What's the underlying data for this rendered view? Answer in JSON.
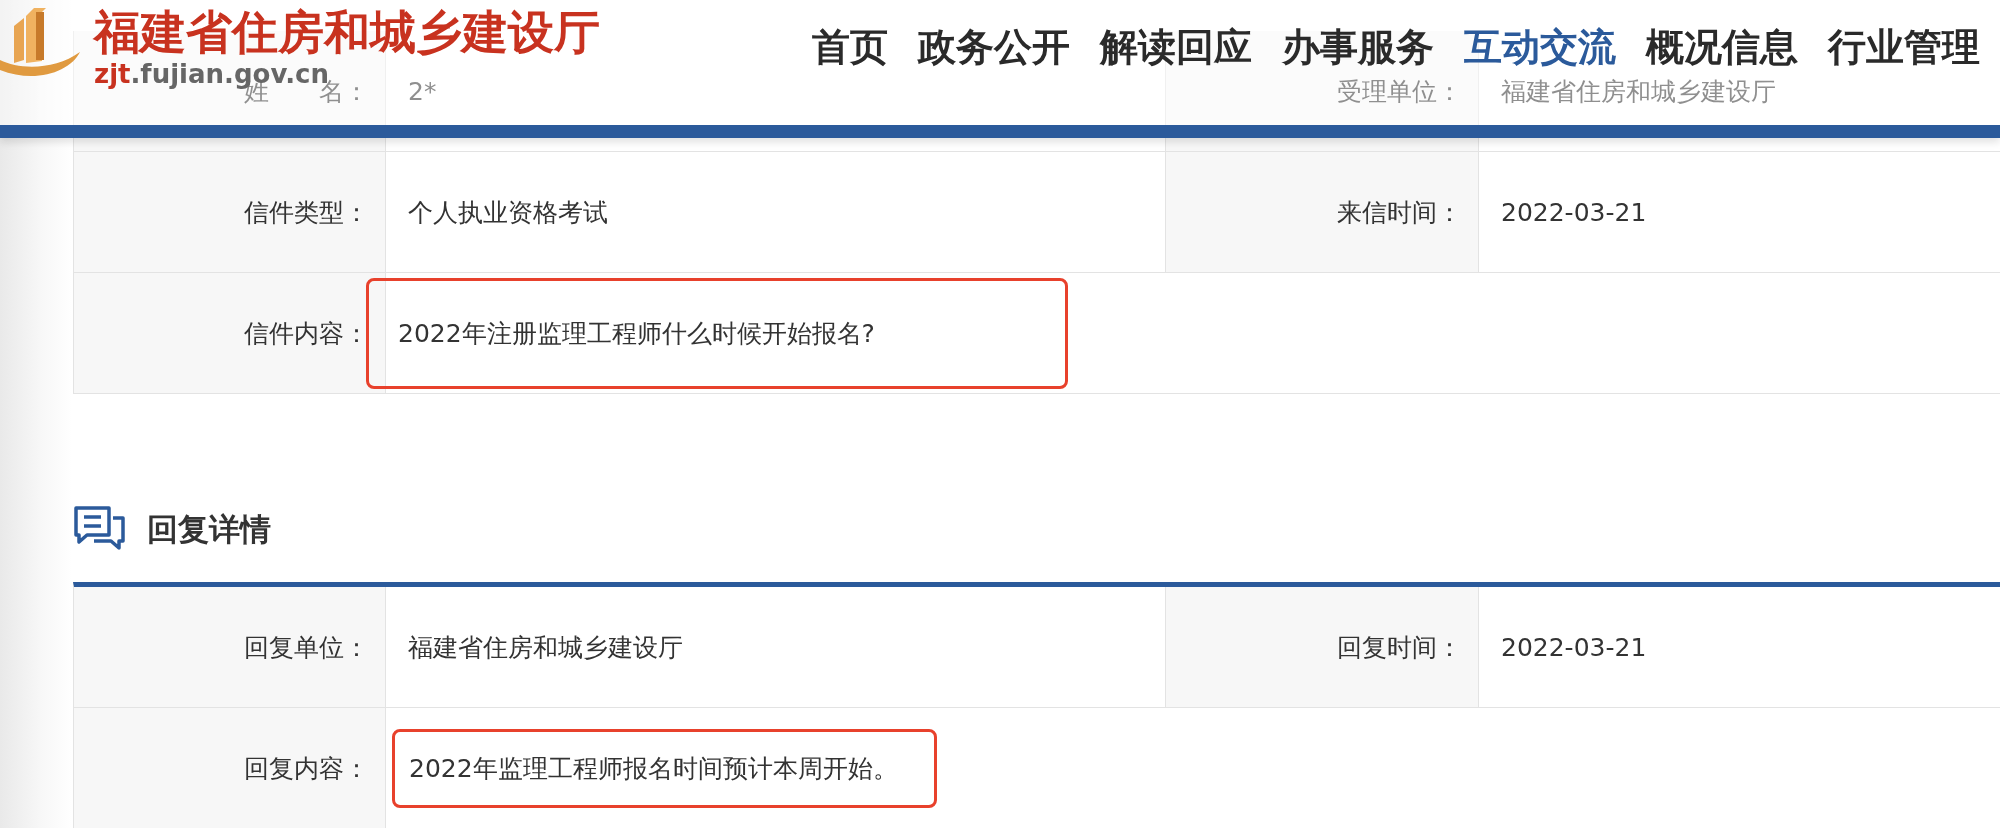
{
  "header": {
    "site_name": "福建省住房和城乡建设厅",
    "domain_prefix": "zjt",
    "domain_rest": ".fujian.gov.cn",
    "nav": [
      {
        "label": "首页",
        "selected": false
      },
      {
        "label": "政务公开",
        "selected": false
      },
      {
        "label": "解读回应",
        "selected": false
      },
      {
        "label": "办事服务",
        "selected": false
      },
      {
        "label": "互动交流",
        "selected": true
      },
      {
        "label": "概况信息",
        "selected": false
      },
      {
        "label": "行业管理",
        "selected": false
      }
    ]
  },
  "letter": {
    "rows": [
      {
        "cells": [
          {
            "label": "姓　　名：",
            "value": "2*",
            "highlighted": false
          },
          {
            "label": "受理单位：",
            "value": "福建省住房和城乡建设厅",
            "highlighted": false
          }
        ]
      },
      {
        "cells": [
          {
            "label": "信件类型：",
            "value": "个人执业资格考试",
            "highlighted": false
          },
          {
            "label": "来信时间：",
            "value": "2022-03-21",
            "highlighted": false
          }
        ]
      },
      {
        "cells": [
          {
            "label": "信件内容：",
            "value": "2022年注册监理工程师什么时候开始报名?",
            "highlighted": true
          }
        ]
      }
    ]
  },
  "reply": {
    "title": "回复详情",
    "rows": [
      {
        "cells": [
          {
            "label": "回复单位：",
            "value": "福建省住房和城乡建设厅",
            "highlighted": false
          },
          {
            "label": "回复时间：",
            "value": "2022-03-21",
            "highlighted": false
          }
        ]
      },
      {
        "cells": [
          {
            "label": "回复内容：",
            "value": "2022年监理工程师报名时间预计本周开始。",
            "highlighted": true
          }
        ]
      }
    ]
  }
}
